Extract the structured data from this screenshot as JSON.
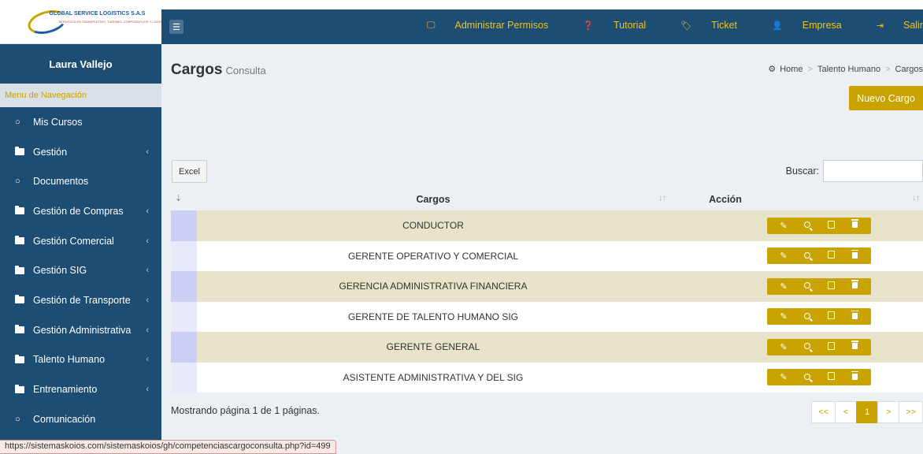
{
  "brand": {
    "logo_text": "GLOBAL SERVICE LOGISTICS S.A.S",
    "logo_sub": "SERVICIOS EN TRANSPORTES, TURISMO, CORPORATIVOS Y LOGISTICOS"
  },
  "user": {
    "name": "Laura Vallejo"
  },
  "sidebar": {
    "header": "Menu de Navegación",
    "items": [
      {
        "label": "Mis Cursos",
        "icon": "circle-icon",
        "has_children": false
      },
      {
        "label": "Gestión",
        "icon": "folder-icon",
        "has_children": true
      },
      {
        "label": "Documentos",
        "icon": "circle-icon",
        "has_children": false
      },
      {
        "label": "Gestión de Compras",
        "icon": "folder-icon",
        "has_children": true
      },
      {
        "label": "Gestión Comercial",
        "icon": "folder-icon",
        "has_children": true
      },
      {
        "label": "Gestión SIG",
        "icon": "folder-icon",
        "has_children": true
      },
      {
        "label": "Gestión de Transporte",
        "icon": "folder-icon",
        "has_children": true
      },
      {
        "label": "Gestión Administrativa",
        "icon": "folder-icon",
        "has_children": true
      },
      {
        "label": "Talento Humano",
        "icon": "folder-icon",
        "has_children": true
      },
      {
        "label": "Entrenamiento",
        "icon": "folder-icon",
        "has_children": true
      },
      {
        "label": "Comunicación",
        "icon": "circle-icon",
        "has_children": false
      }
    ]
  },
  "topnav": {
    "permisos": "Administrar Permisos",
    "tutorial": "Tutorial",
    "ticket": "Ticket",
    "empresa": "Empresa",
    "salir": "Salir"
  },
  "page": {
    "title": "Cargos",
    "subtitle": "Consulta"
  },
  "breadcrumb": {
    "home": "Home",
    "section": "Talento Humano",
    "current": "Cargos"
  },
  "actions": {
    "new_label": "Nuevo Cargo",
    "excel_label": "Excel",
    "search_label": "Buscar:",
    "search_value": ""
  },
  "table": {
    "headers": {
      "cargos": "Cargos",
      "accion": "Acción"
    },
    "rows": [
      "CONDUCTOR",
      "GERENTE OPERATIVO Y COMERCIAL",
      "GERENCIA ADMINISTRATIVA FINANCIERA",
      "GERENTE DE TALENTO HUMANO SIG",
      "GERENTE GENERAL",
      "ASISTENTE ADMINISTRATIVA Y DEL SIG"
    ]
  },
  "pagination": {
    "info": "Mostrando página 1 de 1 páginas.",
    "first": "<<",
    "prev": "<",
    "current": "1",
    "next": ">",
    "last": ">>"
  },
  "status_url": "https://sistemaskoios.com/sistemaskoios/gh/competenciascargoconsulta.php?id=499",
  "colors": {
    "primary": "#1e4d73",
    "accent": "#c9a300",
    "link": "#f0c419"
  }
}
